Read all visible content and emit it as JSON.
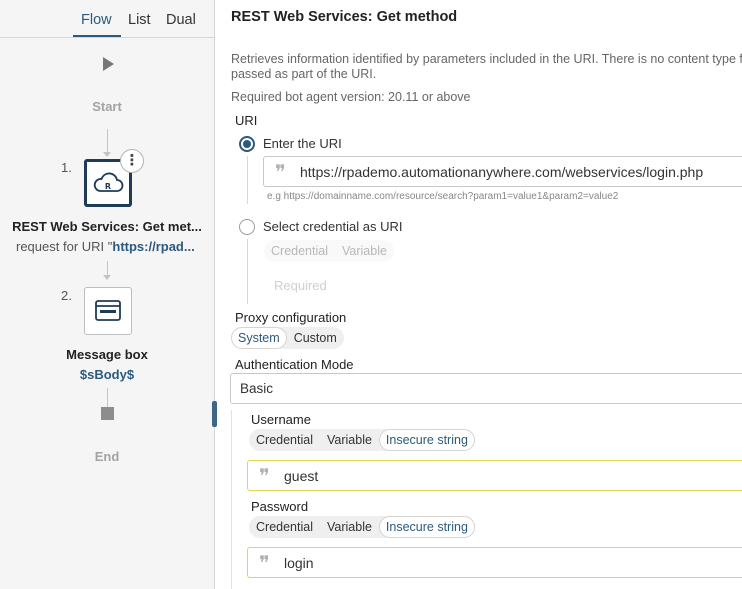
{
  "view_tabs": {
    "flow": "Flow",
    "list": "List",
    "dual": "Dual"
  },
  "flow": {
    "start_label": "Start",
    "end_label": "End",
    "steps": [
      {
        "number": "1.",
        "title": "REST Web Services: Get met...",
        "subtitle_prefix": "request for URI \"",
        "subtitle_link": "https://rpad...",
        "icon": "rest-cloud-icon",
        "menu_glyph": "⋮"
      },
      {
        "number": "2.",
        "title": "Message box",
        "variable": "$sBody$",
        "icon": "message-box-icon"
      }
    ]
  },
  "panel": {
    "title": "REST Web Services: Get method",
    "description": "Retrieves information identified by parameters included in the URI. There is no content type fo passed as part of the URI.",
    "required_version": "Required bot agent version: 20.11 or above",
    "uri": {
      "label": "URI",
      "option_enter": "Enter the URI",
      "value": "https://rpademo.automationanywhere.com/webservices/login.php",
      "hint": "e.g https://domainname.com/resource/search?param1=value1&param2=value2",
      "option_credential": "Select credential as URI",
      "cred_tabs": [
        "Credential",
        "Variable"
      ],
      "required_placeholder": "Required"
    },
    "proxy": {
      "label": "Proxy configuration",
      "options": [
        "System",
        "Custom"
      ],
      "selected": "System"
    },
    "auth": {
      "label": "Authentication Mode",
      "value": "Basic",
      "username": {
        "label": "Username",
        "tabs": [
          "Credential",
          "Variable",
          "Insecure string"
        ],
        "selected": "Insecure string",
        "value": "guest"
      },
      "password": {
        "label": "Password",
        "tabs": [
          "Credential",
          "Variable",
          "Insecure string"
        ],
        "selected": "Insecure string",
        "value": "login"
      }
    }
  },
  "colors": {
    "accent": "#2b5a7e",
    "warn_border": "#e3d553",
    "node_selected": "#1e3c57"
  }
}
